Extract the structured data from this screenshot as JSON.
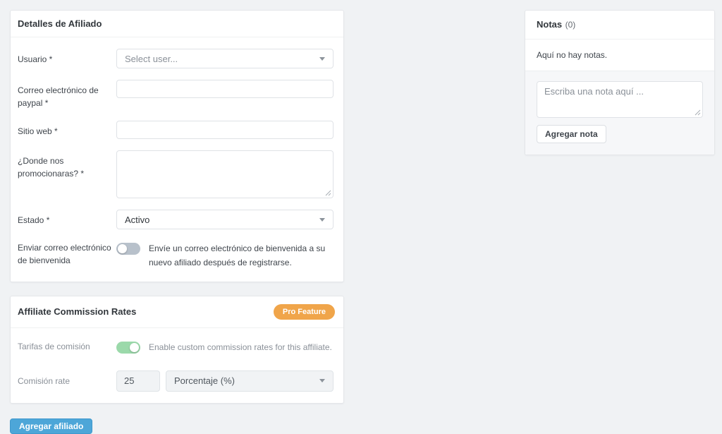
{
  "details": {
    "title": "Detalles de Afiliado",
    "user_label": "Usuario *",
    "user_value": "Select user...",
    "paypal_label": "Correo electrónico de paypal *",
    "paypal_value": "",
    "website_label": "Sitio web *",
    "website_value": "",
    "promote_label": "¿Donde nos promocionaras? *",
    "promote_value": "",
    "status_label": "Estado *",
    "status_value": "Activo",
    "welcome_label": "Enviar correo electrónico de bienvenida",
    "welcome_description": "Envíe un correo electrónico de bienvenida a su nuevo afiliado después de registrarse.",
    "welcome_toggle": "off"
  },
  "commission": {
    "title": "Affiliate Commission Rates",
    "badge": "Pro Feature",
    "rates_label": "Tarifas de comisión",
    "rates_description": "Enable custom commission rates for this affiliate.",
    "rates_toggle": "on",
    "rate_label": "Comisión rate",
    "rate_value": "25",
    "rate_type_value": "Porcentaje (%)"
  },
  "actions": {
    "submit": "Agregar afiliado"
  },
  "notes": {
    "title": "Notas",
    "count": "(0)",
    "empty": "Aquí no hay notas.",
    "placeholder": "Escriba una nota aquí ...",
    "note_value": "",
    "add": "Agregar nota"
  },
  "colors": {
    "accent_blue": "#4da6d8",
    "badge_orange": "#f0a54a",
    "toggle_on_green": "#9bd9aa",
    "toggle_off_gray": "#b8c1cb",
    "page_background": "#f0f2f4"
  }
}
